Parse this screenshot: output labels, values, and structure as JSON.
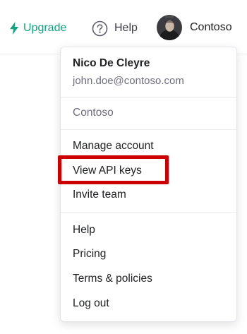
{
  "topbar": {
    "upgrade_label": "Upgrade",
    "help_label": "Help",
    "org_name": "Contoso"
  },
  "menu": {
    "user_name": "Nico De Cleyre",
    "user_email": "john.doe@contoso.com",
    "organization": "Contoso",
    "items": [
      {
        "label": "Manage account"
      },
      {
        "label": "View API keys"
      },
      {
        "label": "Invite team"
      },
      {
        "label": "Help"
      },
      {
        "label": "Pricing"
      },
      {
        "label": "Terms & policies"
      },
      {
        "label": "Log out"
      }
    ]
  },
  "colors": {
    "accent": "#10a37f",
    "highlight_border": "#cc0000",
    "secondary_text": "#6e6e80"
  },
  "icons": {
    "upgrade": "lightning-bolt-icon",
    "help": "question-circle-icon"
  }
}
